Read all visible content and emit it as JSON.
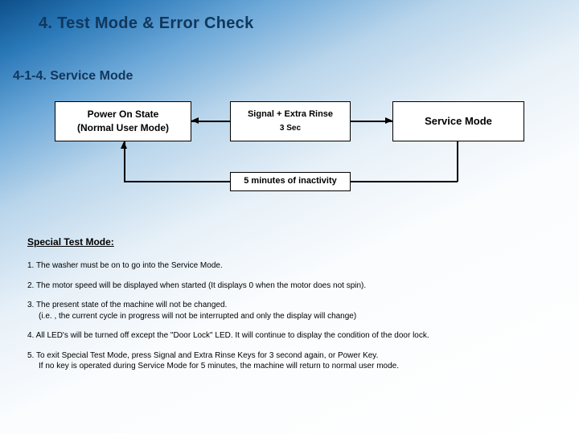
{
  "header": {
    "title": "4. Test Mode & Error Check",
    "subtitle": "4-1-4.  Service Mode"
  },
  "diagram": {
    "left": {
      "line1": "Power On State",
      "line2": "(Normal User Mode)"
    },
    "mid": {
      "line1": "Signal + Extra Rinse",
      "line2": "3 Sec"
    },
    "right": {
      "label": "Service Mode"
    },
    "bottom": {
      "label": "5 minutes of inactivity"
    }
  },
  "special": {
    "heading": "Special Test  Mode:",
    "items": [
      {
        "lines": [
          "1. The washer must be on to go into the Service Mode."
        ]
      },
      {
        "lines": [
          "2. The motor speed will be displayed when started (It displays 0 when the motor does not spin)."
        ]
      },
      {
        "lines": [
          "3. The present state of the machine will not be changed.",
          "(i.e. , the current cycle in progress will not be interrupted and only the display will change)"
        ]
      },
      {
        "lines": [
          "4. All LED's will be turned off except the \"Door Lock\" LED. It will continue to display the condition of the door lock."
        ]
      },
      {
        "lines": [
          "5. To exit Special Test Mode, press Signal and Extra Rinse Keys for 3 second again, or Power Key.",
          "If no key is operated during Service Mode for 5 minutes, the machine will return to normal user mode."
        ]
      }
    ]
  }
}
